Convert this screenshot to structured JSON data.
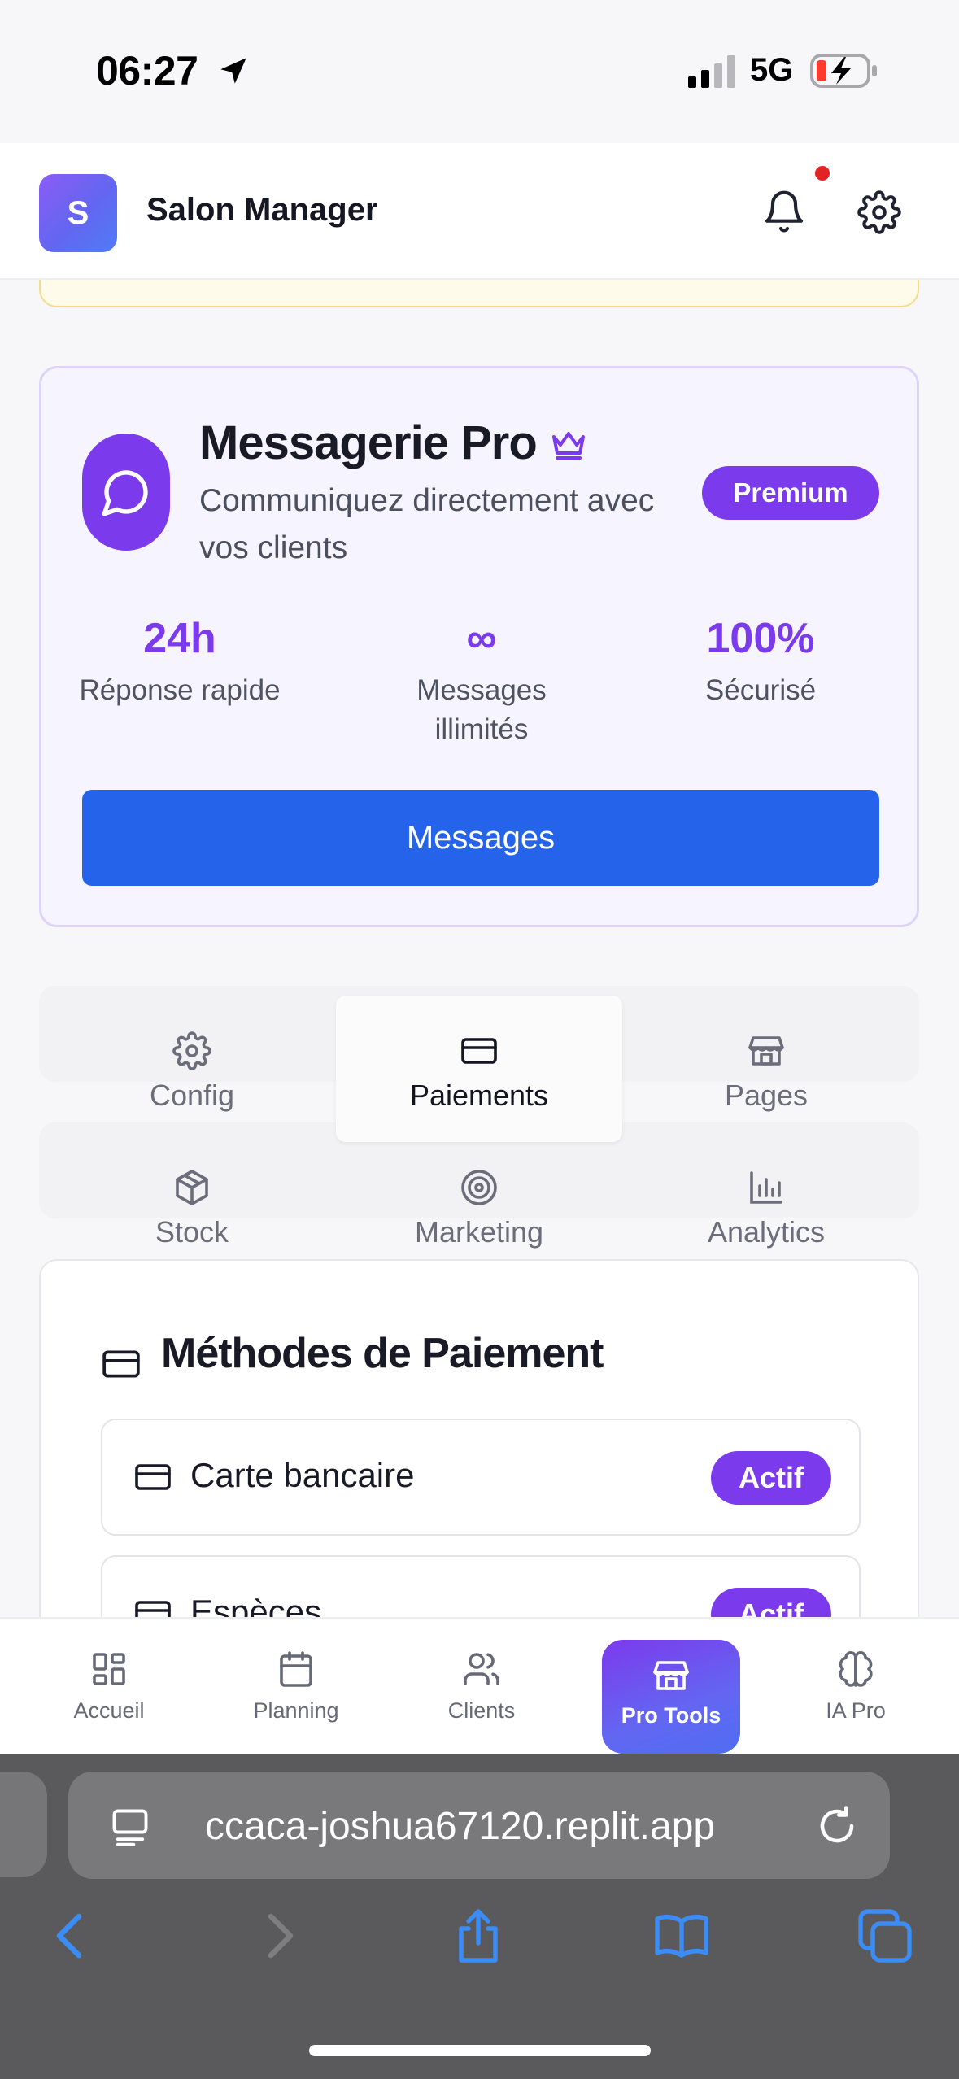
{
  "status_bar": {
    "time": "06:27",
    "network": "5G"
  },
  "header": {
    "logo_letter": "S",
    "title": "Salon Manager",
    "has_notification": true
  },
  "messaging_card": {
    "title": "Messagerie Pro",
    "subtitle": "Communiquez directement avec vos clients",
    "badge": "Premium",
    "stats": [
      {
        "value": "24h",
        "label": "Réponse rapide"
      },
      {
        "value": "∞",
        "label": "Messages illimités"
      },
      {
        "value": "100%",
        "label": "Sécurisé"
      }
    ],
    "button_label": "Messages"
  },
  "tabs": [
    {
      "label": "Config",
      "icon": "gear-icon",
      "active": false
    },
    {
      "label": "Paiements",
      "icon": "credit-card-icon",
      "active": true
    },
    {
      "label": "Pages",
      "icon": "store-icon",
      "active": false
    },
    {
      "label": "Stock",
      "icon": "package-icon",
      "active": false
    },
    {
      "label": "Marketing",
      "icon": "target-icon",
      "active": false
    },
    {
      "label": "Analytics",
      "icon": "bar-chart-icon",
      "active": false
    }
  ],
  "payment_methods": {
    "title": "Méthodes de Paiement",
    "items": [
      {
        "label": "Carte bancaire",
        "status": "Actif"
      },
      {
        "label": "Espèces",
        "status": "Actif"
      }
    ]
  },
  "bottom_nav": [
    {
      "label": "Accueil",
      "icon": "dashboard-icon",
      "active": false
    },
    {
      "label": "Planning",
      "icon": "calendar-icon",
      "active": false
    },
    {
      "label": "Clients",
      "icon": "users-icon",
      "active": false
    },
    {
      "label": "Pro Tools",
      "icon": "store-icon",
      "active": true
    },
    {
      "label": "IA Pro",
      "icon": "brain-icon",
      "active": false
    }
  ],
  "browser": {
    "url": "ccaca-joshua67120.replit.app"
  },
  "colors": {
    "accent": "#7c3aed",
    "primary_button": "#2563eb",
    "notification": "#e02424"
  }
}
